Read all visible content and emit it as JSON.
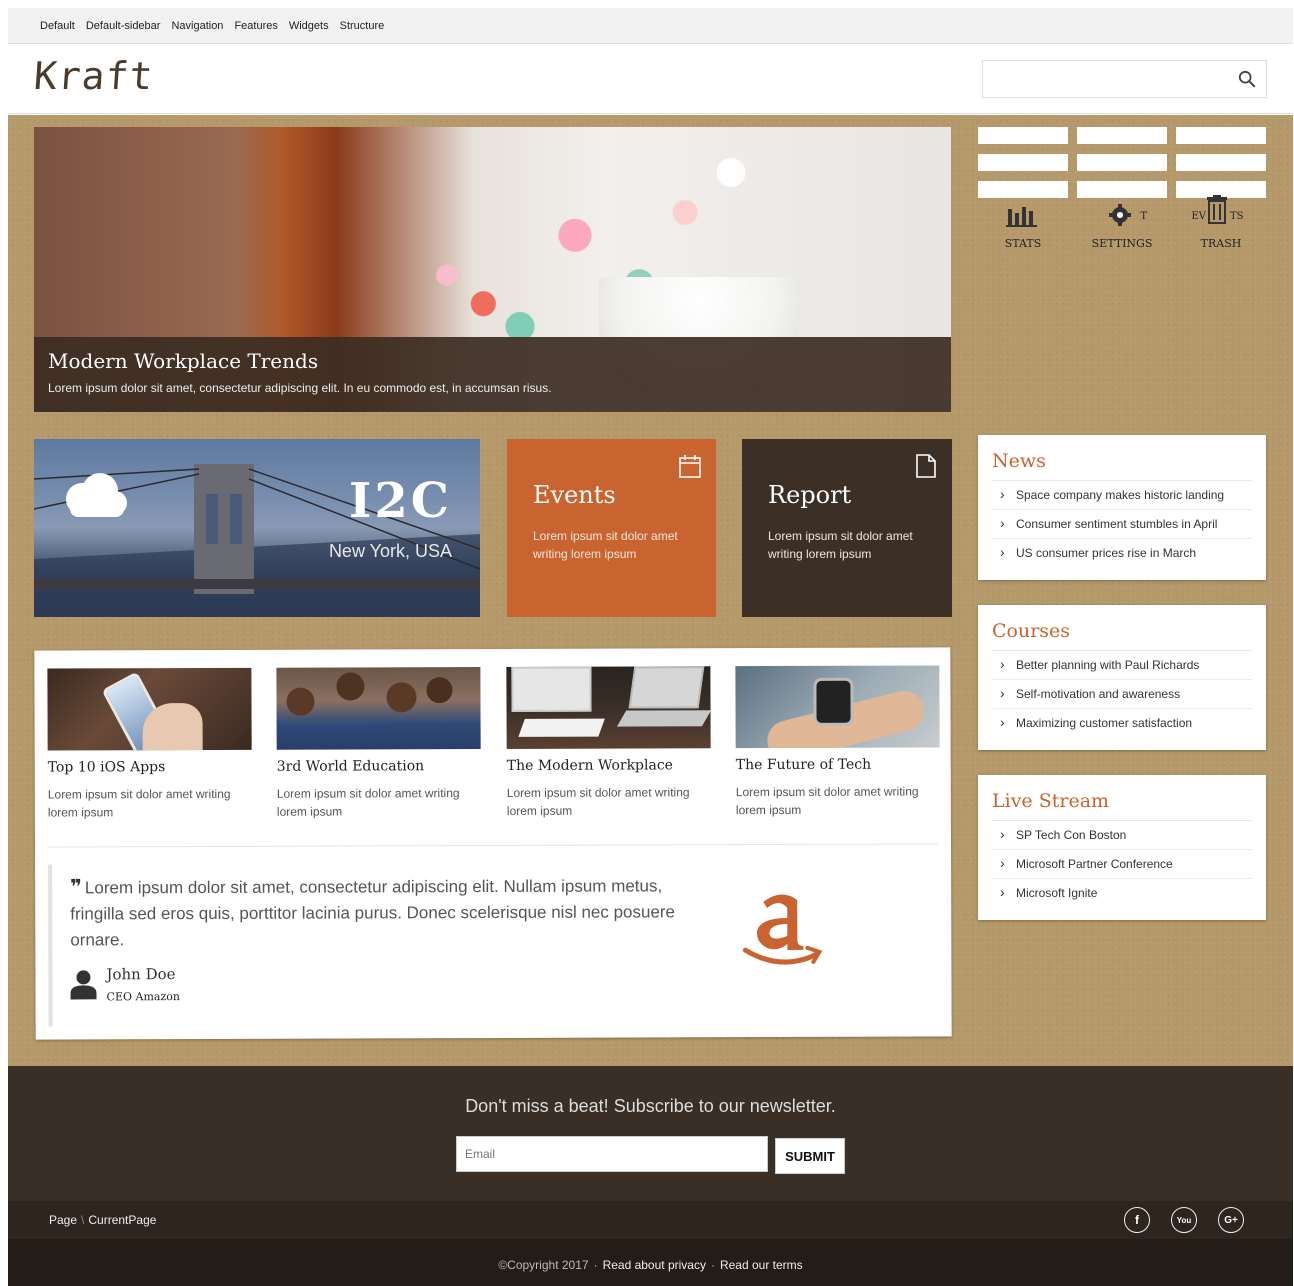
{
  "topnav": [
    "Default",
    "Default-sidebar",
    "Navigation",
    "Features",
    "Widgets",
    "Structure"
  ],
  "header": {
    "logo": "Kraft",
    "search_placeholder": ""
  },
  "hero": {
    "title": "Modern Workplace Trends",
    "text": "Lorem ipsum dolor sit amet, consectetur adipiscing elit. In eu commodo est, in accumsan risus."
  },
  "icons": {
    "stats": "STATS",
    "settings": "SETTINGS",
    "trash": "TRASH",
    "events_fragment": "EV",
    "events_fragment_end": "TS",
    "chat_fragment": "T",
    "icon_names": [
      "stats-icon",
      "settings-icon",
      "trash-icon"
    ]
  },
  "tiles": {
    "city": {
      "title": "I2C",
      "subtitle": "New York, USA"
    },
    "events": {
      "title": "Events",
      "text": "Lorem ipsum sit dolor amet writing lorem ipsum"
    },
    "report": {
      "title": "Report",
      "text": "Lorem ipsum sit dolor amet writing lorem ipsum"
    }
  },
  "articles": [
    {
      "title": "Top 10 iOS Apps",
      "text": "Lorem ipsum sit dolor amet writing lorem ipsum"
    },
    {
      "title": "3rd World Education",
      "text": "Lorem ipsum sit dolor amet writing lorem ipsum"
    },
    {
      "title": "The Modern Workplace",
      "text": "Lorem ipsum sit dolor amet writing lorem ipsum"
    },
    {
      "title": "The Future of Tech",
      "text": "Lorem ipsum sit dolor amet writing lorem ipsum"
    }
  ],
  "quote": {
    "text": "Lorem ipsum dolor sit amet, consectetur adipiscing elit. Nullam ipsum metus, fringilla sed eros quis, porttitor lacinia purus. Donec scelerisque nisl nec posuere ornare.",
    "author": "John Doe",
    "role": "CEO Amazon"
  },
  "widgets": {
    "news": {
      "title": "News",
      "items": [
        "Space company makes historic landing",
        "Consumer sentiment stumbles in April",
        "US consumer prices rise in March"
      ]
    },
    "courses": {
      "title": "Courses",
      "items": [
        "Better planning with Paul Richards",
        "Self-motivation and awareness",
        "Maximizing customer satisfaction"
      ]
    },
    "livestream": {
      "title": "Live Stream",
      "items": [
        "SP Tech Con Boston",
        "Microsoft Partner Conference",
        "Microsoft Ignite"
      ]
    }
  },
  "newsletter": {
    "title": "Don't miss a beat! Subscribe to our newsletter.",
    "email_placeholder": "Email",
    "submit_label": "SUBMIT"
  },
  "breadcrumb": {
    "page": "Page",
    "sep": "\\",
    "current": "CurrentPage"
  },
  "social": {
    "facebook": "f",
    "youtube": "You",
    "google": "G+"
  },
  "copyright": {
    "text": "©Copyright 2017",
    "privacy": "Read about privacy",
    "terms": "Read our terms"
  },
  "colors": {
    "accent": "#c9632f",
    "dark": "#3a2f27",
    "cork": "#b5996b"
  }
}
